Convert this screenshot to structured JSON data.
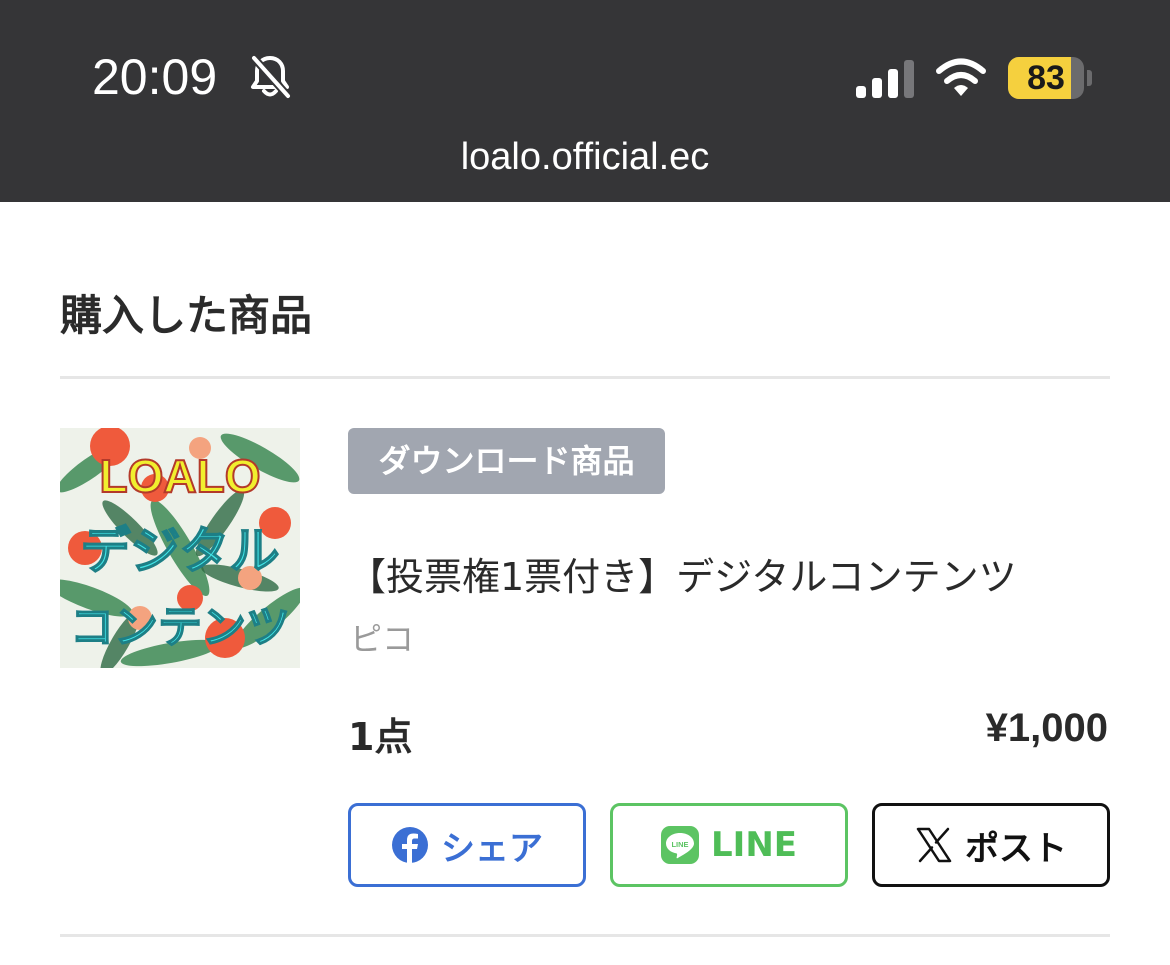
{
  "status_bar": {
    "time": "20:09",
    "battery_level": "83",
    "battery_fraction": 0.83,
    "icons": [
      "bell-slash-icon",
      "cellular-signal-icon",
      "wifi-icon",
      "battery-icon"
    ]
  },
  "browser": {
    "url": "loalo.official.ec"
  },
  "page": {
    "section_title": "購入した商品"
  },
  "item": {
    "badge": "ダウンロード商品",
    "name": "【投票権1票付き】デジタルコンテンツ",
    "seller": "ピコ",
    "quantity": "1点",
    "price": "¥1,000",
    "thumbnail": {
      "line1": "LOALO",
      "line2": "デジタル",
      "line3": "コンテンツ"
    }
  },
  "share": {
    "facebook_label": "シェア",
    "line_label": "LINE",
    "x_label": "ポスト"
  },
  "colors": {
    "status_bar_bg": "#353537",
    "badge_bg": "#a1a6b0",
    "facebook": "#3b6fd4",
    "line": "#5cc463",
    "x": "#111111",
    "battery_fill": "#f5d03e"
  }
}
